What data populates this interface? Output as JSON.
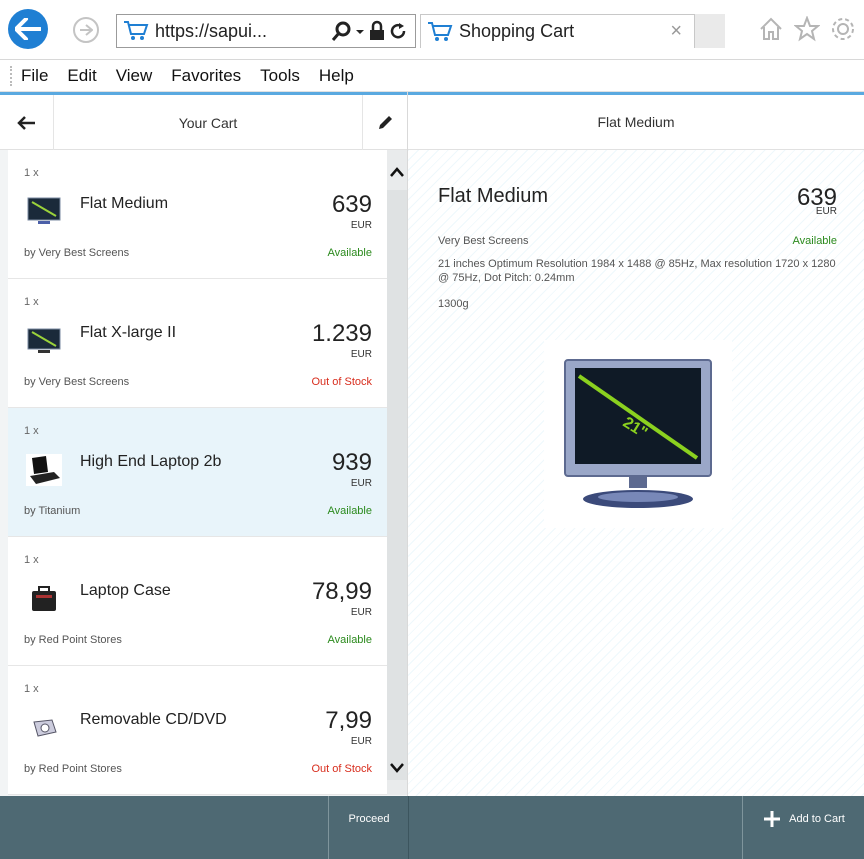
{
  "browser": {
    "url": "https://sapui...",
    "tab_title": "Shopping Cart",
    "tab_close": "×"
  },
  "menu": [
    "File",
    "Edit",
    "View",
    "Favorites",
    "Tools",
    "Help"
  ],
  "master": {
    "title": "Your Cart",
    "items": [
      {
        "qty": "1 x",
        "name": "Flat Medium",
        "price": "639",
        "currency": "EUR",
        "vendor": "by Very Best Screens",
        "status": "Available",
        "status_type": "ok",
        "icon": "monitor-icon"
      },
      {
        "qty": "1 x",
        "name": "Flat X-large II",
        "price": "1.239",
        "currency": "EUR",
        "vendor": "by Very Best Screens",
        "status": "Out of Stock",
        "status_type": "bad",
        "icon": "monitor-icon"
      },
      {
        "qty": "1 x",
        "name": "High End Laptop 2b",
        "price": "939",
        "currency": "EUR",
        "vendor": "by Titanium",
        "status": "Available",
        "status_type": "ok",
        "icon": "laptop-icon"
      },
      {
        "qty": "1 x",
        "name": "Laptop Case",
        "price": "78,99",
        "currency": "EUR",
        "vendor": "by Red Point Stores",
        "status": "Available",
        "status_type": "ok",
        "icon": "laptop-case-icon"
      },
      {
        "qty": "1 x",
        "name": "Removable CD/DVD",
        "price": "7,99",
        "currency": "EUR",
        "vendor": "by Red Point Stores",
        "status": "Out of Stock",
        "status_type": "bad",
        "icon": "cd-drive-icon"
      }
    ]
  },
  "detail": {
    "header": "Flat Medium",
    "name": "Flat Medium",
    "price": "639",
    "currency": "EUR",
    "vendor": "Very Best Screens",
    "status": "Available",
    "description": "21 inches Optimum Resolution 1984 x 1488 @ 85Hz, Max resolution 1720 x 1280 @ 75Hz, Dot Pitch: 0.24mm",
    "weight": "1300g",
    "image_label": "21\""
  },
  "footer": {
    "proceed": "Proceed",
    "add_to_cart": "Add to Cart"
  },
  "colors": {
    "accent": "#1f7fd3",
    "header_bar": "#5aa9e0",
    "footer": "#4e6973",
    "available": "#2b8a1d",
    "out_of_stock": "#d82d1d",
    "selected_row": "#e8f4fa"
  }
}
